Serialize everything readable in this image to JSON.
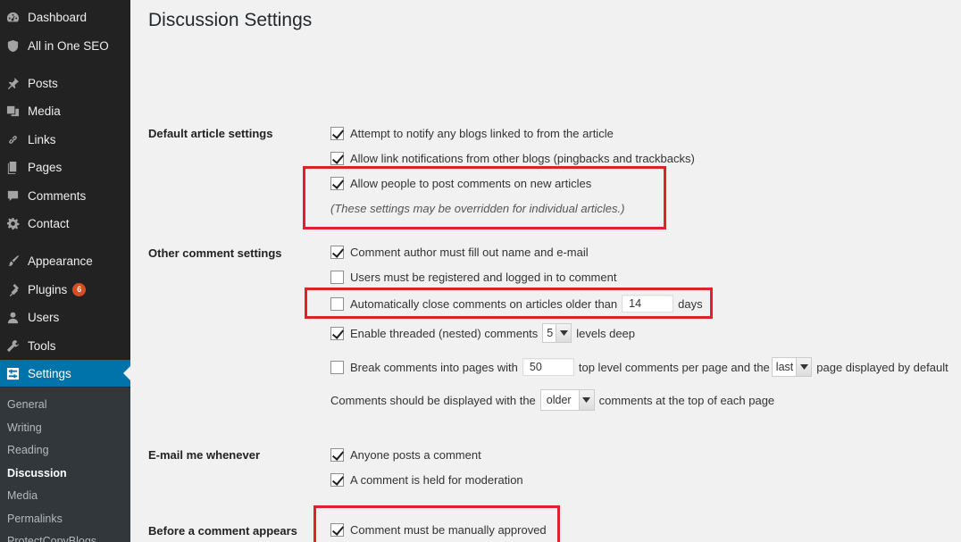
{
  "sidebar": {
    "items": [
      {
        "label": "Dashboard",
        "icon": "dashboard-icon"
      },
      {
        "label": "All in One SEO",
        "icon": "shield-icon"
      },
      {
        "label": "Posts",
        "icon": "pin-icon"
      },
      {
        "label": "Media",
        "icon": "media-icon"
      },
      {
        "label": "Links",
        "icon": "link-icon"
      },
      {
        "label": "Pages",
        "icon": "pages-icon"
      },
      {
        "label": "Comments",
        "icon": "comment-icon"
      },
      {
        "label": "Contact",
        "icon": "gear-icon"
      },
      {
        "label": "Appearance",
        "icon": "brush-icon"
      },
      {
        "label": "Plugins",
        "icon": "plugin-icon",
        "badge": "6"
      },
      {
        "label": "Users",
        "icon": "user-icon"
      },
      {
        "label": "Tools",
        "icon": "wrench-icon"
      },
      {
        "label": "Settings",
        "icon": "settings-icon",
        "active": true
      }
    ],
    "submenu": [
      "General",
      "Writing",
      "Reading",
      "Discussion",
      "Media",
      "Permalinks",
      "ProtectCopyBlogs"
    ],
    "submenu_current": "Discussion"
  },
  "page": {
    "title": "Discussion Settings"
  },
  "sections": {
    "default_article": {
      "label": "Default article settings",
      "notify_blogs": {
        "label": "Attempt to notify any blogs linked to from the article",
        "checked": true
      },
      "allow_pingbacks": {
        "label": "Allow link notifications from other blogs (pingbacks and trackbacks)",
        "checked": true
      },
      "allow_comments": {
        "label": "Allow people to post comments on new articles",
        "checked": true
      },
      "note": "(These settings may be overridden for individual articles.)"
    },
    "other_comment": {
      "label": "Other comment settings",
      "require_name_email": {
        "label": "Comment author must fill out name and e-mail",
        "checked": true
      },
      "require_registration": {
        "label": "Users must be registered and logged in to comment",
        "checked": false
      },
      "auto_close": {
        "label_before": "Automatically close comments on articles older than",
        "value": "14",
        "label_after": "days",
        "checked": false
      },
      "threaded": {
        "label_before": "Enable threaded (nested) comments",
        "value": "5",
        "label_after": "levels deep",
        "checked": true
      },
      "paging": {
        "label_before": "Break comments into pages with",
        "per_page": "50",
        "label_middle": "top level comments per page and the",
        "page_select": "last",
        "label_after": "page displayed by default",
        "checked": false
      },
      "order": {
        "label_before": "Comments should be displayed with the",
        "value": "older",
        "label_after": "comments at the top of each page"
      }
    },
    "email_me": {
      "label": "E-mail me whenever",
      "anyone_posts": {
        "label": "Anyone posts a comment",
        "checked": true
      },
      "held_moderation": {
        "label": "A comment is held for moderation",
        "checked": true
      }
    },
    "before_appears": {
      "label": "Before a comment appears",
      "manual_approve": {
        "label": "Comment must be manually approved",
        "checked": true
      }
    }
  },
  "colors": {
    "sidebar_bg": "#222222",
    "submenu_bg": "#32373c",
    "active_blue": "#0073aa",
    "highlight_red": "#e0202b",
    "badge_orange": "#d54e21"
  }
}
